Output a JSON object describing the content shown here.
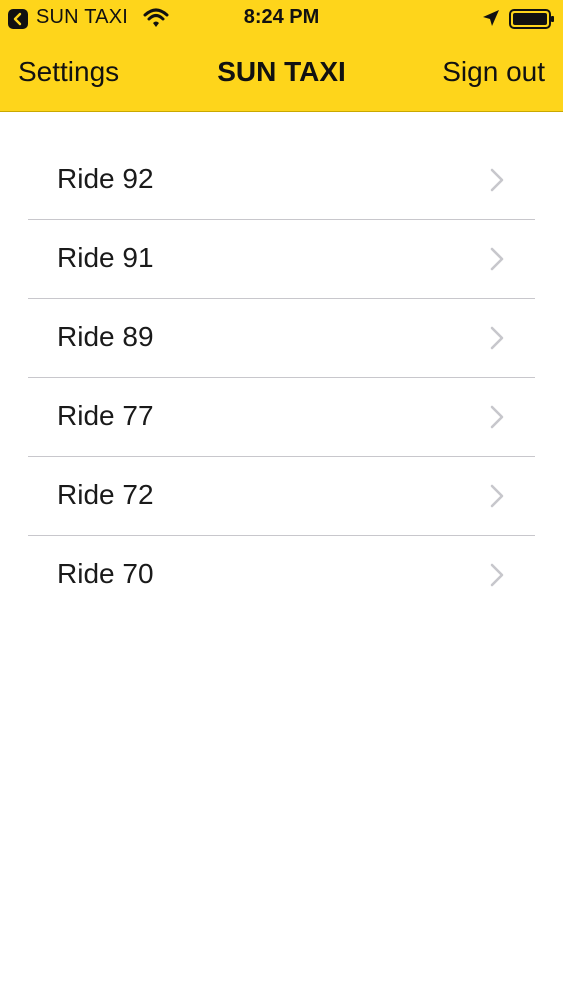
{
  "status_bar": {
    "carrier": "SUN TAXI",
    "time": "8:24 PM",
    "icons": [
      "back-to-app-icon",
      "wifi-icon",
      "location-arrow-icon",
      "battery-icon"
    ]
  },
  "nav": {
    "left_label": "Settings",
    "title": "SUN TAXI",
    "right_label": "Sign out"
  },
  "rides": [
    {
      "label": "Ride 92"
    },
    {
      "label": "Ride 91"
    },
    {
      "label": "Ride 89"
    },
    {
      "label": "Ride 77"
    },
    {
      "label": "Ride 72"
    },
    {
      "label": "Ride 70"
    }
  ],
  "colors": {
    "header_background": "#fed51b",
    "separator": "#c8c7cc",
    "chevron": "#c7c7cc",
    "text": "#111111"
  }
}
